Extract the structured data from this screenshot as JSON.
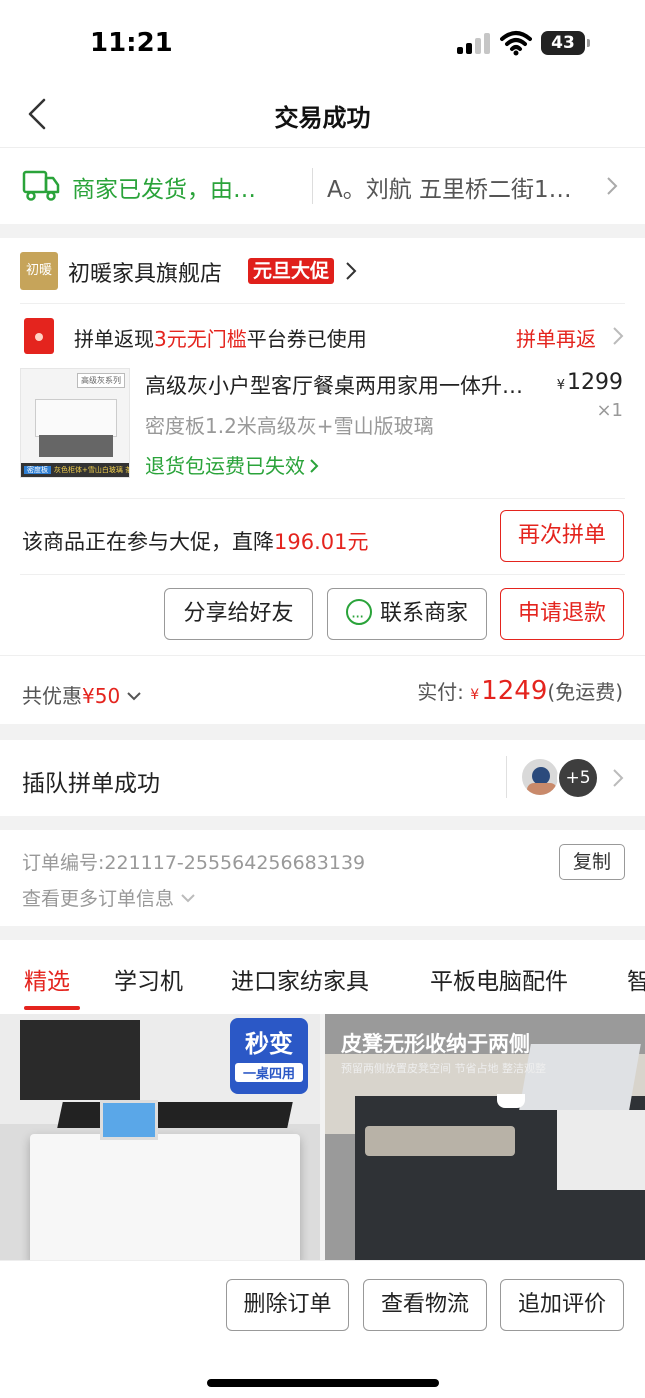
{
  "status_bar": {
    "time": "11:21",
    "battery": "43"
  },
  "nav": {
    "title": "交易成功"
  },
  "logistics": {
    "status": "商家已发货，由…",
    "address": "A。刘航 五里桥二街1…"
  },
  "shop": {
    "logo_text": "初暖",
    "name": "初暖家具旗舰店",
    "promo_tag": "元旦大促"
  },
  "coupon": {
    "text_prefix": "拼单返现",
    "text_highlight": "3元无门槛",
    "text_suffix": "平台券已使用",
    "link": "拼单再返"
  },
  "product": {
    "thumb_tag": "高级灰系列",
    "thumb_bar_tag": "密度板",
    "thumb_bar_text": "灰色柜体+雪山白玻璃 茶几",
    "title": "高级灰小户型客厅餐桌两用家用一体升降茶几",
    "price_symbol": "¥",
    "price": "1299",
    "quantity": "×1",
    "spec": "密度板1.2米高级灰+雪山版玻璃",
    "return_note": "退货包运费已失效"
  },
  "promo": {
    "text": "该商品正在参与大促，直降",
    "amount": "196.01元",
    "rebuy_button": "再次拼单"
  },
  "actions": {
    "share": "分享给好友",
    "contact": "联系商家",
    "refund": "申请退款"
  },
  "summary": {
    "discount_label": "共优惠",
    "discount_amount": "¥50",
    "paid_label": "实付:",
    "paid_symbol": "¥",
    "paid_amount": "1249",
    "shipping": "(免运费)"
  },
  "group": {
    "title": "插队拼单成功",
    "more_count": "+5"
  },
  "order_info": {
    "number_label": "订单编号:",
    "number": "221117-255564256683139",
    "copy_button": "复制",
    "more": "查看更多订单信息"
  },
  "tabs": [
    "精选",
    "学习机",
    "进口家纺家具",
    "平板电脑配件",
    "智"
  ],
  "recommend": [
    {
      "badge_main": "秒变",
      "badge_sub": "一桌四用"
    },
    {
      "headline": "皮凳无形收纳于两侧",
      "sub": "预留两侧放置皮凳空间 节省占地 整洁观整"
    }
  ],
  "bottom_bar": {
    "delete": "删除订单",
    "logistics": "查看物流",
    "review": "追加评价"
  },
  "colors": {
    "accent": "#e4241e",
    "green": "#2aa33a"
  }
}
